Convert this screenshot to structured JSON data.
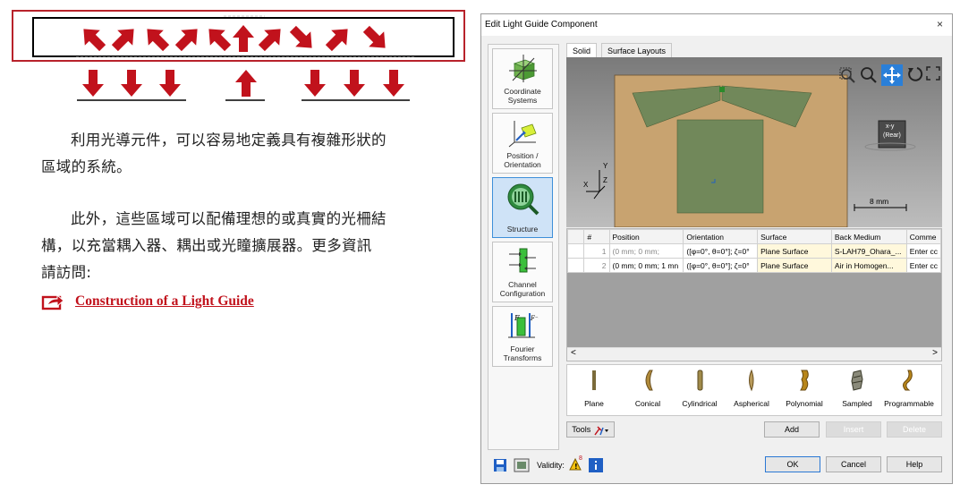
{
  "article": {
    "para1_line1": "利用光導元件，可以容易地定義具有複雜形狀的",
    "para1_line2": "區域的系統。",
    "para2_line1": "此外，這些區域可以配備理想的或真實的光柵結",
    "para2_line2": "構，以充當耦入器、耦出或光瞳擴展器。更多資訊",
    "para2_line3": "請訪問:",
    "link_text": "Construction of a Light Guide",
    "accent_color": "#c1121c"
  },
  "dialog": {
    "title": "Edit Light Guide Component",
    "close_glyph": "×",
    "sidebar": [
      {
        "label": "Coordinate Systems",
        "icon": "coordinate-cube-icon"
      },
      {
        "label": "Position / Orientation",
        "icon": "position-icon"
      },
      {
        "label": "Structure",
        "icon": "structure-icon",
        "selected": true
      },
      {
        "label": "Channel Configuration",
        "icon": "channel-icon"
      },
      {
        "label": "Fourier Transforms",
        "icon": "fourier-icon"
      }
    ],
    "tabs": [
      "Solid",
      "Surface Layouts"
    ],
    "viewport": {
      "axis_y": "Y",
      "axis_x": "X",
      "axis_z": "Z",
      "view_label": "x-y",
      "view_sub": "(Rear)",
      "scale": "8 mm"
    },
    "table": {
      "headers": [
        "",
        "#",
        "Position",
        "Orientation",
        "Surface",
        "Back Medium",
        "Comme"
      ],
      "rows": [
        [
          "",
          "1",
          "(0 mm; 0 mm;",
          "([φ=0°, θ=0°]; ζ=0°",
          "Plane Surface",
          "S-LAH79_Ohara_...",
          "Enter cc"
        ],
        [
          "",
          "2",
          "(0 mm; 0 mm; 1 mn",
          "([φ=0°, θ=0°]; ζ=0°",
          "Plane Surface",
          "Air in Homogen...",
          "Enter cc"
        ]
      ],
      "scroll_left": "<",
      "scroll_right": ">"
    },
    "surfaces": [
      "Plane",
      "Conical",
      "Cylindrical",
      "Aspherical",
      "Polynomial",
      "Sampled",
      "Programmable"
    ],
    "buttons": {
      "tools": "Tools",
      "add": "Add",
      "insert": "Insert",
      "delete": "Delete",
      "validity": "Validity:",
      "validity_count": "8",
      "ok": "OK",
      "cancel": "Cancel",
      "help": "Help"
    }
  }
}
